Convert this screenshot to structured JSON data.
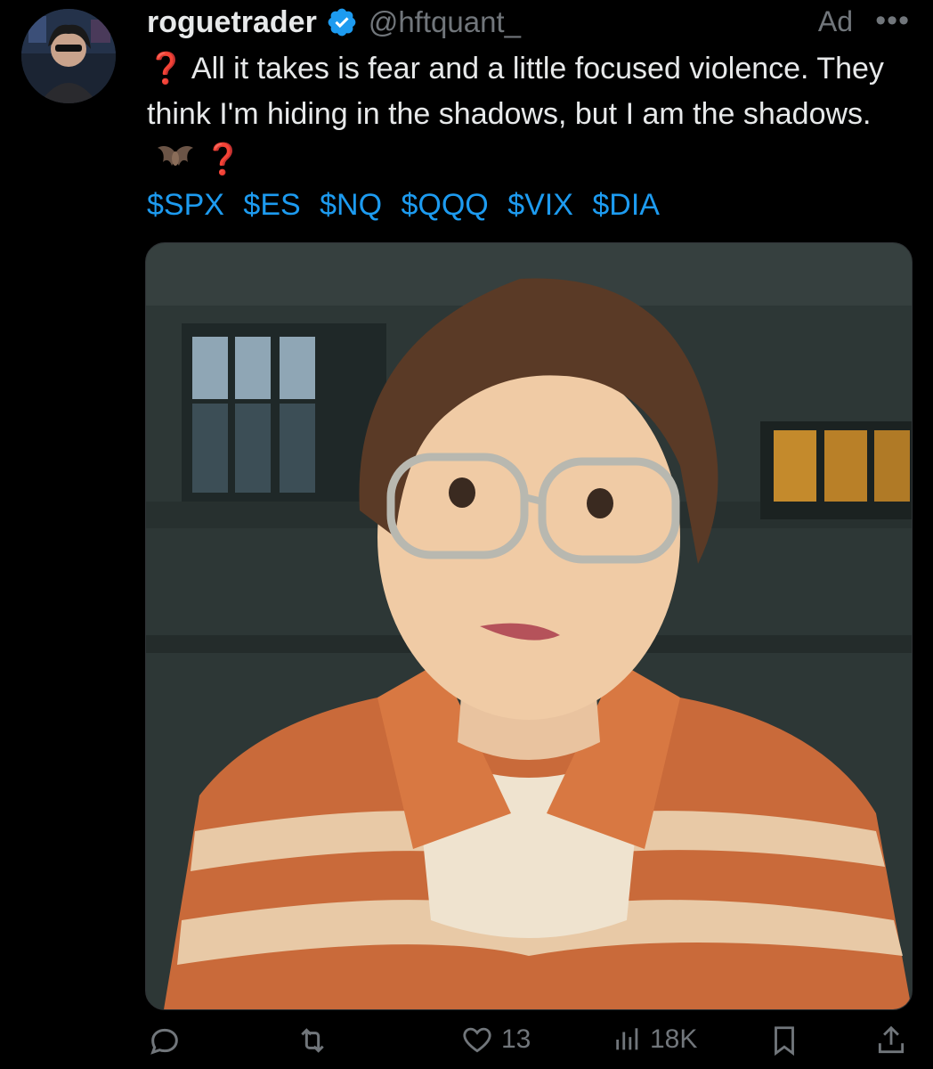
{
  "tweet": {
    "display_name": "roguetrader",
    "handle": "@hftquant_",
    "ad_label": "Ad",
    "more_label": "•••",
    "text_q1": "❓",
    "text_main": " All it takes is fear and a little  focused violence. They think I'm hiding in the shadows, but I am the shadows.",
    "text_q2": "❓",
    "cashtags": [
      "$SPX",
      "$ES",
      "$NQ",
      "$QQQ",
      "$VIX",
      "$DIA"
    ]
  },
  "actions": {
    "likes": "13",
    "views": "18K"
  },
  "colors": {
    "background": "#000000",
    "text": "#e7e9ea",
    "muted": "#71767b",
    "link": "#1d9bf0",
    "verified": "#1d9bf0",
    "question_mark": "#e0245e"
  },
  "icons": [
    "verified-badge-icon",
    "more-icon",
    "bat-emoji",
    "reply-icon",
    "retweet-icon",
    "like-icon",
    "views-icon",
    "bookmark-icon",
    "share-icon"
  ]
}
